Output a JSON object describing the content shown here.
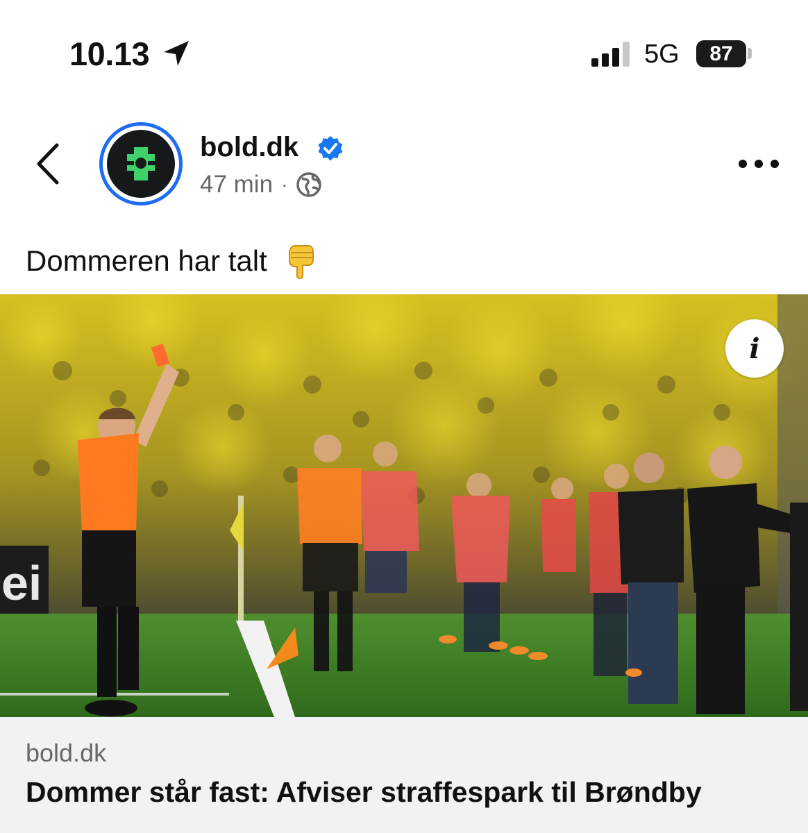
{
  "status_bar": {
    "time": "10.13",
    "network": "5G",
    "battery": "87",
    "location_icon": "location-arrow-icon",
    "signal_icon": "cellular-signal-icon"
  },
  "post": {
    "page_name": "bold.dk",
    "verified_icon": "verified-badge-icon",
    "timestamp": "47 min",
    "separator": "·",
    "audience_icon": "globe-icon",
    "text": "Dommeren har talt",
    "text_emoji": "backhand-index-pointing-down",
    "image_description": "Referee holding up a card on a football pitch in front of a crowd in yellow",
    "info_label": "i"
  },
  "link_preview": {
    "domain": "bold.dk",
    "title": "Dommer står fast: Afviser straffespark til Brøndby"
  },
  "colors": {
    "accent_blue": "#1d6cf3",
    "verified_blue": "#1877f2",
    "logo_green": "#3fd16a",
    "secondary_text": "#65676b",
    "card_background": "#f0f2f5",
    "referee_orange": "#ff7a1f",
    "crowd_yellow": "#e6cc23"
  }
}
